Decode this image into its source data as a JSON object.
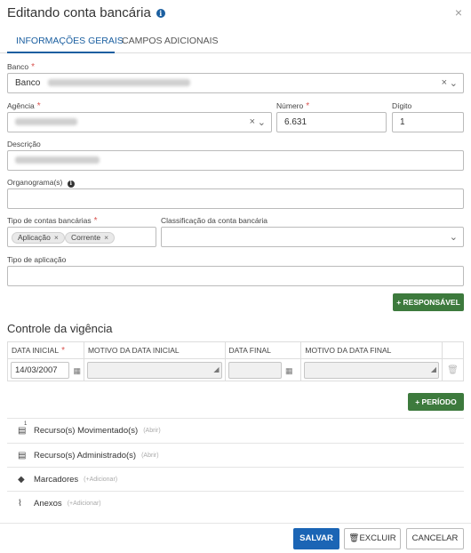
{
  "header": {
    "title": "Editando conta bancária",
    "info_icon": "i",
    "close_icon": "×"
  },
  "tabs": [
    {
      "label": "INFORMAÇÕES GERAIS",
      "active": true
    },
    {
      "label": "CAMPOS ADICIONAIS",
      "active": false
    }
  ],
  "form": {
    "banco": {
      "label": "Banco",
      "required_mark": "*",
      "value_prefix": "Banco"
    },
    "agencia": {
      "label": "Agência",
      "required_mark": "*"
    },
    "numero": {
      "label": "Número",
      "required_mark": "*",
      "value": "6.631"
    },
    "digito": {
      "label": "Dígito",
      "value": "1"
    },
    "descricao": {
      "label": "Descrição"
    },
    "organograma": {
      "label": "Organograma(s)",
      "info_icon": "i"
    },
    "tipo_contas": {
      "label": "Tipo de contas bancárias",
      "required_mark": "*",
      "chips": [
        "Aplicação",
        "Corrente"
      ]
    },
    "classificacao": {
      "label": "Classificação da conta bancária"
    },
    "tipo_aplicacao": {
      "label": "Tipo de aplicação"
    },
    "responsavel_button": "+ RESPONSÁVEL"
  },
  "vigencia": {
    "title": "Controle da vigência",
    "columns": [
      "DATA INICIAL",
      "MOTIVO DA DATA INICIAL",
      "DATA FINAL",
      "MOTIVO DA DATA FINAL"
    ],
    "required_mark": "*",
    "row": {
      "data_inicial": "14/03/2007",
      "motivo_inicial": "",
      "data_final": "",
      "motivo_final": ""
    },
    "periodo_button": "+ PERÍODO"
  },
  "accordion": [
    {
      "icon": "file-icon",
      "badge": "1",
      "label": "Recurso(s) Movimentado(s)",
      "hint": "(Abrir)"
    },
    {
      "icon": "file-icon",
      "badge": "",
      "label": "Recurso(s) Administrado(s)",
      "hint": "(Abrir)"
    },
    {
      "icon": "tag-icon",
      "badge": "",
      "label": "Marcadores",
      "hint": "(+Adicionar)"
    },
    {
      "icon": "paperclip-icon",
      "badge": "",
      "label": "Anexos",
      "hint": "(+Adicionar)"
    }
  ],
  "footer": {
    "save": "SALVAR",
    "delete": "EXCLUIR",
    "cancel": "CANCELAR"
  },
  "colors": {
    "primary": "#1b65b5",
    "success": "#3d7a3d",
    "required": "#d9534f"
  }
}
